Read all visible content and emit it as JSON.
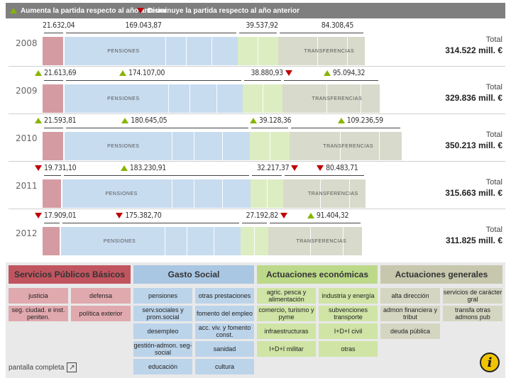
{
  "legend": {
    "increase": "Aumenta la partida respecto al año anterior",
    "decrease": "Disminuye la partida respecto al año anterior",
    "colors": {
      "increase": "#86b500",
      "decrease": "#c00000"
    }
  },
  "chart_data": {
    "type": "bar",
    "orientation": "horizontal-stacked",
    "title": "",
    "xlabel": "",
    "ylabel": "",
    "units": "mill. €",
    "total_label": "Total",
    "categories": [
      "2008",
      "2009",
      "2010",
      "2011",
      "2012"
    ],
    "series": [
      {
        "name": "Servicios Públicos Básicos",
        "color": "#d59ba2",
        "values": [
          21632.04,
          21613.69,
          21593.81,
          19731.1,
          17909.01
        ],
        "value_labels": [
          "21.632,04",
          "21.613,69",
          "21.593,81",
          "19.731,10",
          "17.909,01"
        ],
        "change": [
          "",
          "up",
          "up",
          "down",
          "down"
        ]
      },
      {
        "name": "Gasto Social",
        "color": "#c8dcf0",
        "segment_label": "PENSIONES",
        "values": [
          169043.87,
          174107.0,
          180645.05,
          183230.91,
          175382.7
        ],
        "value_labels": [
          "169.043,87",
          "174.107,00",
          "180.645,05",
          "183.230,91",
          "175.382,70"
        ],
        "change": [
          "",
          "up",
          "up",
          "up",
          "down"
        ]
      },
      {
        "name": "Actuaciones económicas",
        "color": "#dcedc2",
        "values": [
          39537.92,
          38880.93,
          39128.36,
          32217.37,
          27192.82
        ],
        "value_labels": [
          "39.537,92",
          "38.880,93",
          "39.128,36",
          "32.217,37",
          "27.192,82"
        ],
        "change": [
          "",
          "down",
          "up",
          "down",
          "down"
        ]
      },
      {
        "name": "Actuaciones generales",
        "color": "#d8dacb",
        "segment_label": "TRANSFERENCIAS",
        "values": [
          84308.45,
          95094.32,
          109236.59,
          80483.71,
          91404.32
        ],
        "value_labels": [
          "84.308,45",
          "95.094,32",
          "109.236,59",
          "80.483,71",
          "91.404,32"
        ],
        "change": [
          "",
          "up",
          "up",
          "down",
          "up"
        ]
      }
    ],
    "totals": [
      314522,
      329836,
      350213,
      315663,
      311825
    ],
    "total_labels": [
      "314.522",
      "329.836",
      "350.213",
      "315.663",
      "311.825"
    ],
    "total_change": [
      "",
      "up",
      "up",
      "down",
      "down"
    ]
  },
  "panel": {
    "columns": [
      {
        "title": "Servicios Públicos Básicos",
        "color": "#c05560",
        "items": [
          "justicia",
          "defensa",
          "seg. ciudad. e inst. peniten.",
          "política exterior"
        ]
      },
      {
        "title": "Gasto Social",
        "color": "#a9c6e3",
        "items": [
          "pensiones",
          "otras prestaciones",
          "serv.sociales y prom.social",
          "fomento del empleo",
          "desempleo",
          "acc. viv. y fomento const.",
          "gestión-admon. seg-social",
          "sanidad",
          "educación",
          "cultura"
        ]
      },
      {
        "title": "Actuaciones económicas",
        "color": "#bcd98a",
        "items": [
          "agric. pesca y alimentación",
          "industria y energía",
          "comercio, turismo y pyme",
          "subvenciones transporte",
          "infraestructuras",
          "I+D+I civil",
          "I+D+I militar",
          "otras"
        ]
      },
      {
        "title": "Actuaciones generales",
        "color": "#c6c7ad",
        "items": [
          "alta dirección",
          "servicios de carácter gral",
          "admon financiera y tribut",
          "transfa otras admons pub",
          "deuda pública"
        ]
      }
    ],
    "fullscreen_label": "pantalla completa",
    "info_icon": "info-icon"
  }
}
